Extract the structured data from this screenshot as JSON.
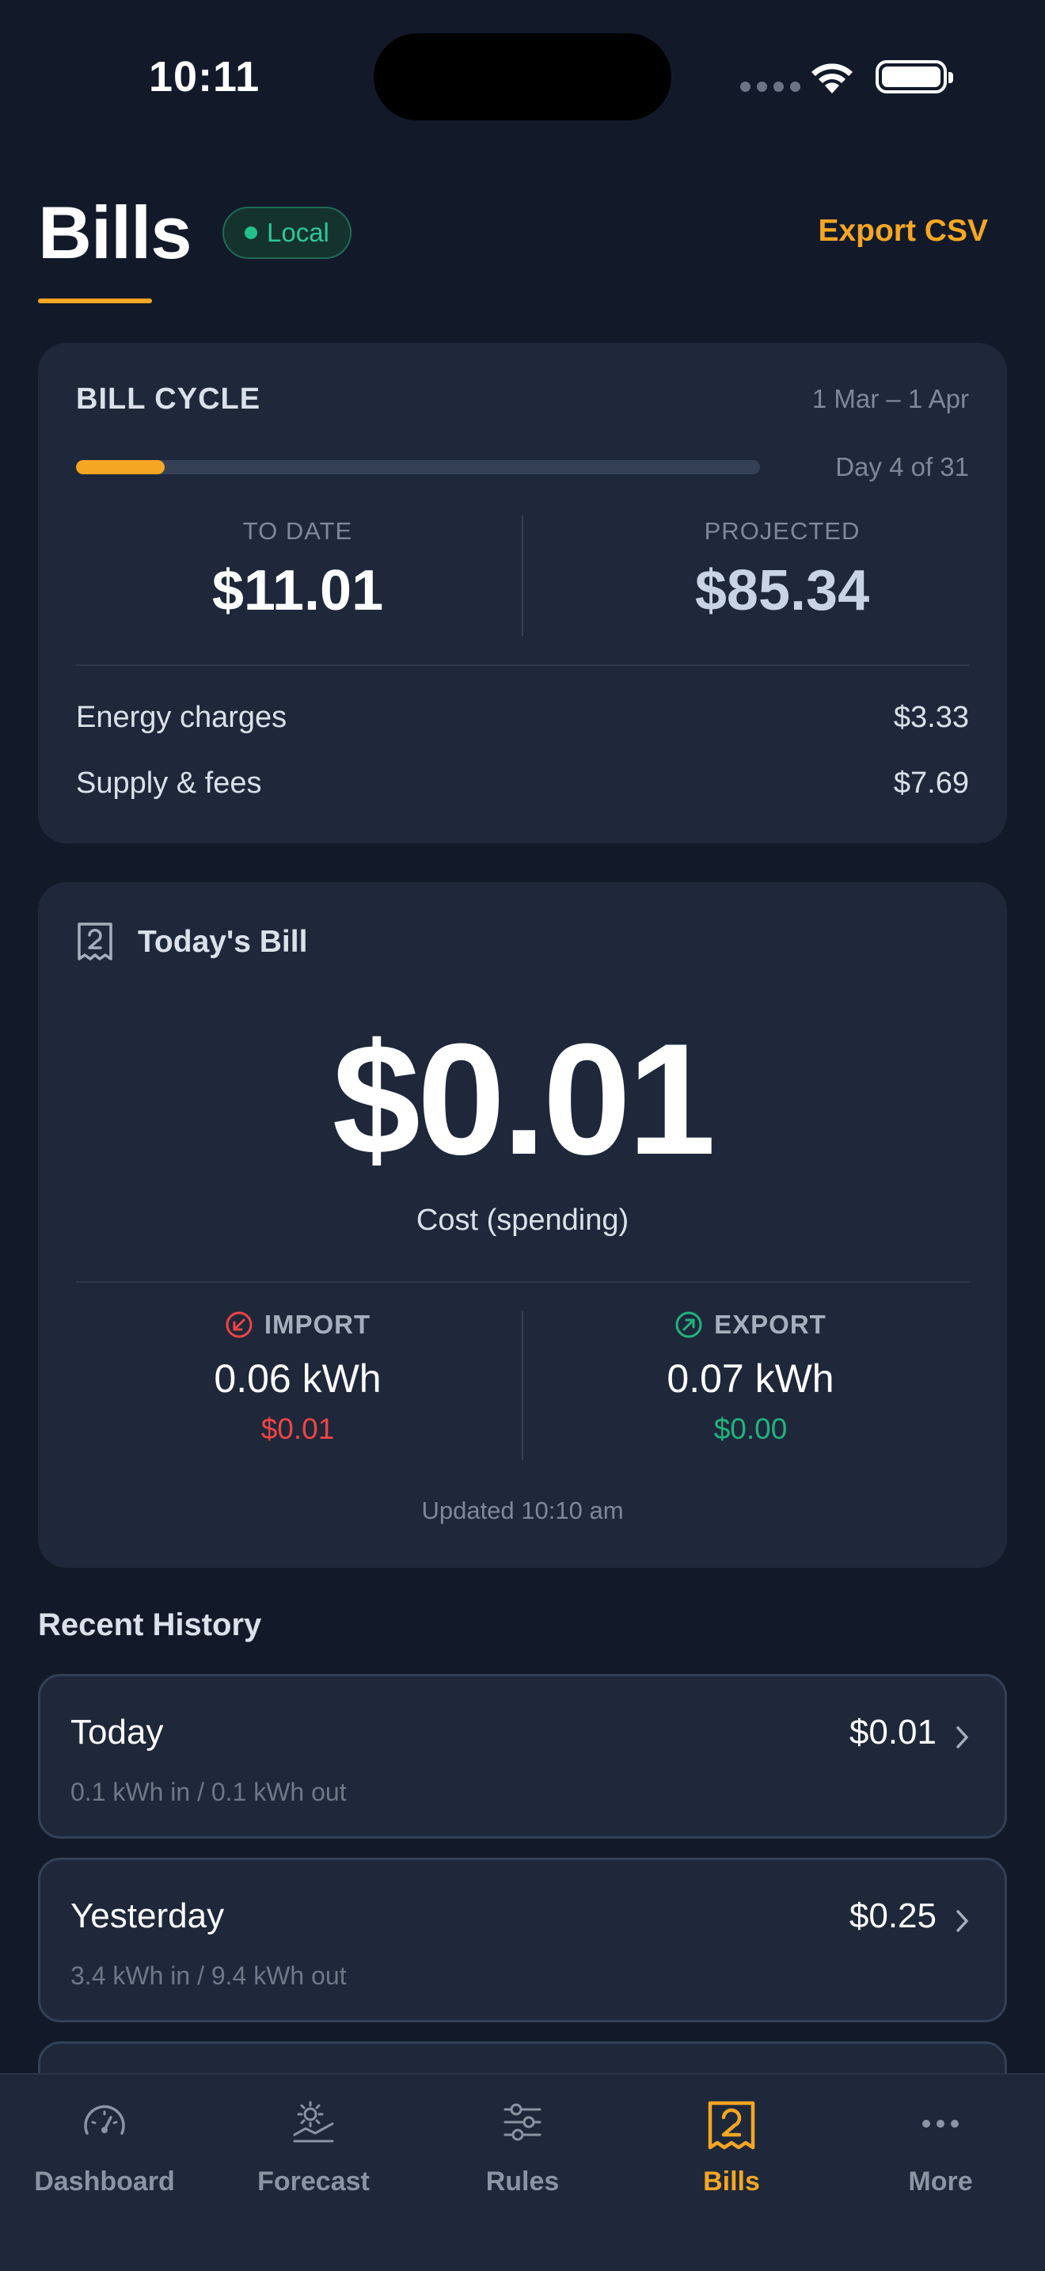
{
  "status_bar": {
    "time": "10:11"
  },
  "header": {
    "title": "Bills",
    "badge": "Local",
    "export_label": "Export CSV"
  },
  "bill_cycle": {
    "label": "BILL CYCLE",
    "dates": "1 Mar – 1 Apr",
    "day_text": "Day 4 of 31",
    "progress_fraction": 0.13,
    "to_date_label": "TO DATE",
    "to_date_value": "$11.01",
    "projected_label": "PROJECTED",
    "projected_value": "$85.34",
    "lines": [
      {
        "label": "Energy charges",
        "value": "$3.33"
      },
      {
        "label": "Supply & fees",
        "value": "$7.69"
      }
    ]
  },
  "todays_bill": {
    "title": "Today's Bill",
    "amount": "$0.01",
    "subtitle": "Cost (spending)",
    "import": {
      "label": "IMPORT",
      "kwh": "0.06 kWh",
      "cost": "$0.01"
    },
    "export": {
      "label": "EXPORT",
      "kwh": "0.07 kWh",
      "cost": "$0.00"
    },
    "updated": "Updated 10:10 am"
  },
  "history": {
    "title": "Recent History",
    "items": [
      {
        "label": "Today",
        "amount": "$0.01",
        "detail": "0.1 kWh in / 0.1 kWh out"
      },
      {
        "label": "Yesterday",
        "amount": "$0.25",
        "detail": "3.4 kWh in / 9.4 kWh out"
      }
    ]
  },
  "tabs": [
    {
      "label": "Dashboard",
      "icon": "gauge-icon"
    },
    {
      "label": "Forecast",
      "icon": "sun-chart-icon"
    },
    {
      "label": "Rules",
      "icon": "sliders-icon"
    },
    {
      "label": "Bills",
      "icon": "receipt-icon",
      "active": true
    },
    {
      "label": "More",
      "icon": "ellipsis-icon"
    }
  ],
  "colors": {
    "accent": "#f5a623",
    "background": "#121a2a",
    "card": "#1e283a",
    "import": "#ef4444",
    "export": "#22b37e",
    "local": "#2cc795"
  }
}
